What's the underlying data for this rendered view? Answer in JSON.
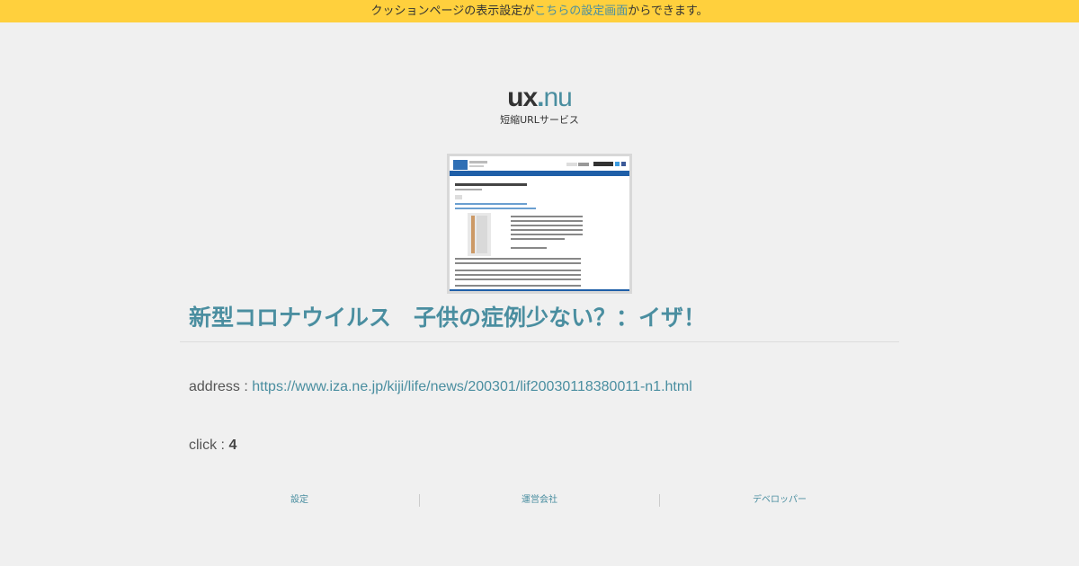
{
  "notice": {
    "prefix": "クッションページの表示設定が",
    "link_text": "こちらの設定画面",
    "suffix": "からできます。"
  },
  "logo": {
    "ux": "ux",
    "dot": ".",
    "nu": "nu",
    "subtitle": "短縮URLサービス"
  },
  "thumbnail": {
    "icon": "page-screenshot-thumbnail"
  },
  "page": {
    "title": "新型コロナウイルス　子供の症例少ない？：イザ！",
    "address_label": "address : ",
    "address_url": "https://www.iza.ne.jp/kiji/life/news/200301/lif20030118380011-n1.html",
    "click_label": "click : ",
    "click_count": "4"
  },
  "footer": {
    "links": [
      "設定",
      "運営会社",
      "デベロッパー"
    ]
  },
  "colors": {
    "notice_bg": "#ffd03d",
    "accent": "#4a8ea0",
    "page_bg": "#f0f0f0"
  }
}
